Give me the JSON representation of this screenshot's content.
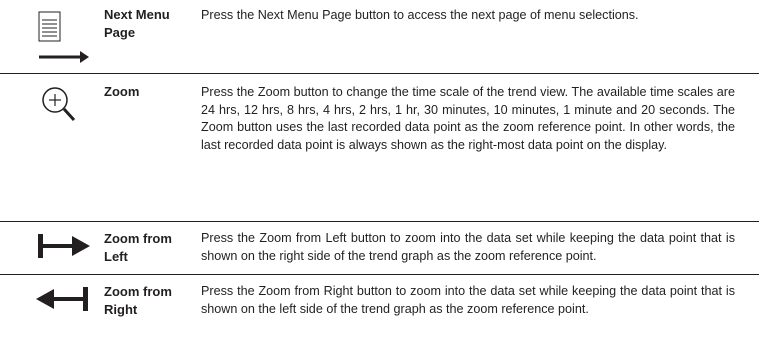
{
  "rows": [
    {
      "name": "Next Menu\nPage",
      "description": "Press the Next Menu Page button to access the next page of menu selections.",
      "icon": "next-menu-page-icon"
    },
    {
      "name": "Zoom",
      "description": "Press the Zoom button to change the time scale of the trend view. The available time scales are 24 hrs, 12 hrs, 8 hrs, 4 hrs, 2 hrs, 1 hr, 30 minutes, 10 minutes, 1 minute and 20 seconds. The Zoom button uses the last recorded data point as the zoom reference point. In other words, the last recorded data point is always shown as the right-most data point on the display.",
      "icon": "zoom-icon"
    },
    {
      "name": "Zoom from\nLeft",
      "description": "Press the Zoom from Left button to zoom into the data set while keeping the data point that is shown on the right side of the trend graph as the zoom reference point.",
      "icon": "zoom-from-left-icon"
    },
    {
      "name": "Zoom from\nRight",
      "description": "Press the Zoom from Right button to zoom into the data set while keeping the data point that is shown on the left side of the trend graph as the zoom reference point.",
      "icon": "zoom-from-right-icon"
    }
  ],
  "colors": {
    "text": "#231f20",
    "rule": "#231f20"
  }
}
